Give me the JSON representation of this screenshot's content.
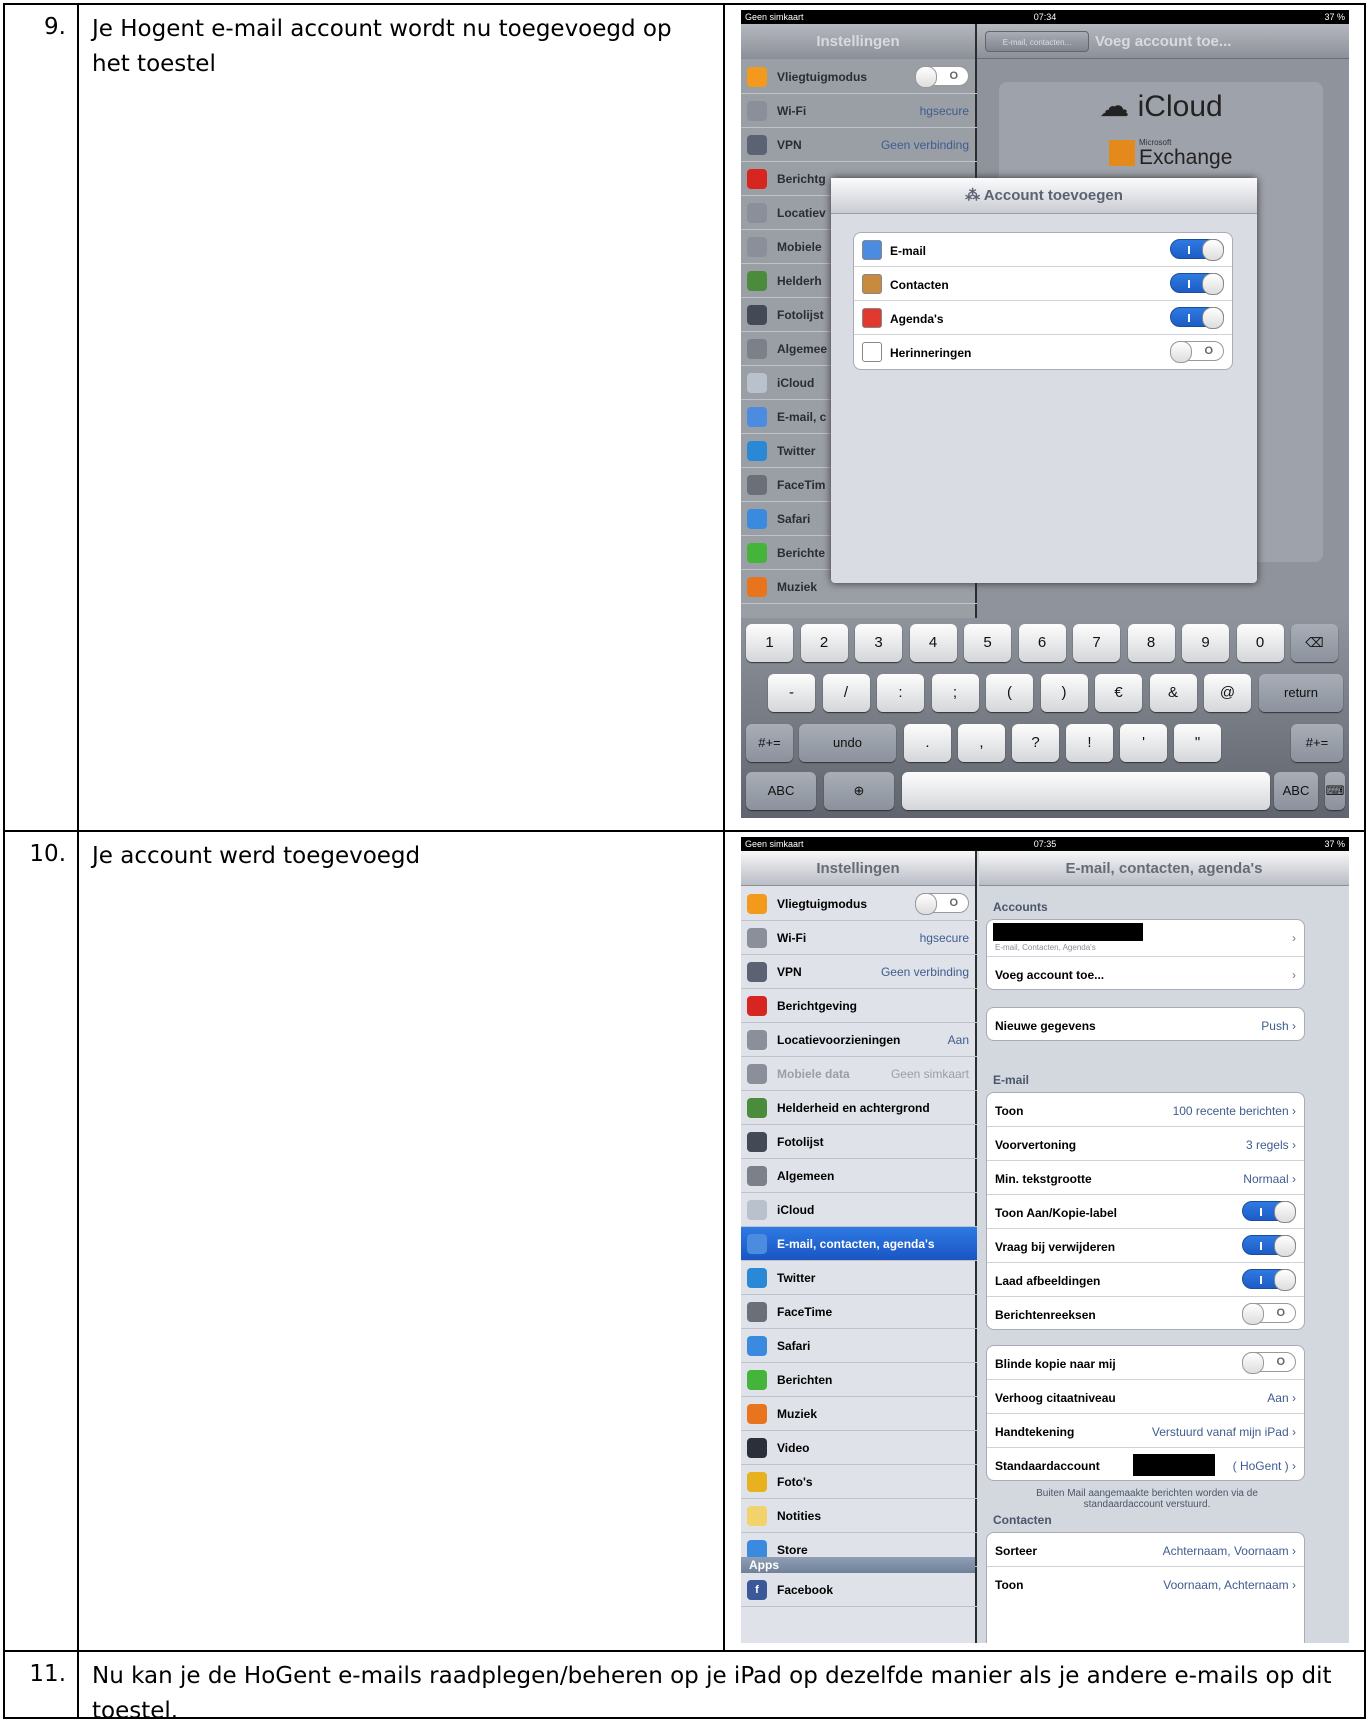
{
  "rows": [
    {
      "num": "9.",
      "text": "Je Hogent e-mail account wordt nu toegevoegd op het toestel"
    },
    {
      "num": "10.",
      "text": "Je account werd toegevoegd"
    },
    {
      "num": "11.",
      "text": "Nu kan je de HoGent e-mails raadplegen/beheren op je iPad op dezelfde manier als je andere e-mails op dit toestel."
    }
  ],
  "shot1": {
    "status": {
      "left": "Geen simkaart",
      "time": "07:34",
      "right": "37 %"
    },
    "left_title": "Instellingen",
    "back_button": "E-mail, contacten...",
    "right_title": "Voeg account toe...",
    "icloud_label": "iCloud",
    "exchange_small": "Microsoft",
    "exchange_label": "Exchange",
    "sidebar": [
      {
        "label": "Vliegtuigmodus",
        "color": "#f39a1d"
      },
      {
        "label": "Wi-Fi",
        "value": "hgsecure",
        "color": "#8a8f99"
      },
      {
        "label": "VPN",
        "value": "Geen verbinding",
        "color": "#5b6373"
      },
      {
        "label": "Berichtg",
        "color": "#d6261f"
      },
      {
        "label": "Locatiev",
        "color": "#8a8f99"
      },
      {
        "label": "Mobiele",
        "color": "#8a8f99"
      },
      {
        "label": "Helderh",
        "color": "#4a8c3c"
      },
      {
        "label": "Fotolijst",
        "color": "#444a55"
      },
      {
        "label": "Algemee",
        "color": "#7b8089"
      },
      {
        "label": "iCloud",
        "color": "#b9c2cc"
      },
      {
        "label": "E-mail, c",
        "color": "#4b8be0"
      },
      {
        "label": "Twitter",
        "color": "#2a89d6"
      },
      {
        "label": "FaceTim",
        "color": "#6a6f78"
      },
      {
        "label": "Safari",
        "color": "#3a8be0"
      },
      {
        "label": "Berichte",
        "color": "#44b53a"
      },
      {
        "label": "Muziek",
        "color": "#e8751e"
      }
    ],
    "dialog_title": "Account toevoegen",
    "dialog_items": [
      {
        "label": "E-mail",
        "on": true,
        "color": "#4b8be0"
      },
      {
        "label": "Contacten",
        "on": true,
        "color": "#c78a3f"
      },
      {
        "label": "Agenda's",
        "on": true,
        "color": "#e03a2f"
      },
      {
        "label": "Herinneringen",
        "on": false,
        "color": "#ffffff"
      }
    ],
    "kb_row1": [
      "1",
      "2",
      "3",
      "4",
      "5",
      "6",
      "7",
      "8",
      "9",
      "0",
      "⌫"
    ],
    "kb_row2": [
      "-",
      "/",
      ":",
      ";",
      "(",
      ")",
      "€",
      "&",
      "@",
      "return"
    ],
    "kb_row3": [
      "#+=",
      "undo",
      ".",
      ",",
      "?",
      "!",
      "'",
      "\"",
      "#+="
    ],
    "kb_row4": [
      "ABC",
      "⊕",
      "",
      "ABC",
      "⌨"
    ]
  },
  "shot2": {
    "status": {
      "left": "Geen simkaart",
      "time": "07:35",
      "right": "37 %"
    },
    "left_title": "Instellingen",
    "right_title": "E-mail, contacten, agenda's",
    "sidebar": [
      {
        "label": "Vliegtuigmodus",
        "color": "#f39a1d"
      },
      {
        "label": "Wi-Fi",
        "value": "hgsecure",
        "color": "#8a8f99"
      },
      {
        "label": "VPN",
        "value": "Geen verbinding",
        "color": "#5b6373"
      },
      {
        "label": "Berichtgeving",
        "color": "#d6261f"
      },
      {
        "label": "Locatievoorzieningen",
        "value": "Aan",
        "color": "#8a8f99"
      },
      {
        "label": "Mobiele data",
        "value": "Geen simkaart",
        "color": "#8a8f99",
        "dim": true
      },
      {
        "label": "Helderheid en achtergrond",
        "color": "#4a8c3c"
      },
      {
        "label": "Fotolijst",
        "color": "#444a55"
      },
      {
        "label": "Algemeen",
        "color": "#7b8089"
      },
      {
        "label": "iCloud",
        "color": "#b9c2cc"
      },
      {
        "label": "E-mail, contacten, agenda's",
        "color": "#4b8be0",
        "selected": true
      },
      {
        "label": "Twitter",
        "color": "#2a89d6"
      },
      {
        "label": "FaceTime",
        "color": "#6a6f78"
      },
      {
        "label": "Safari",
        "color": "#3a8be0"
      },
      {
        "label": "Berichten",
        "color": "#44b53a"
      },
      {
        "label": "Muziek",
        "color": "#e8751e"
      },
      {
        "label": "Video",
        "color": "#2b2f3a"
      },
      {
        "label": "Foto's",
        "color": "#e8b21e"
      },
      {
        "label": "Notities",
        "color": "#f2d36b"
      },
      {
        "label": "Store",
        "color": "#3a8be0"
      }
    ],
    "apps_header": "Apps",
    "facebook": "Facebook",
    "accounts_header": "Accounts",
    "account_sub": "E-mail, Contacten, Agenda's",
    "add_account": "Voeg account toe...",
    "new_data": {
      "label": "Nieuwe gegevens",
      "value": "Push"
    },
    "email_header": "E-mail",
    "email_rows": [
      {
        "label": "Toon",
        "value": "100 recente berichten"
      },
      {
        "label": "Voorvertoning",
        "value": "3 regels"
      },
      {
        "label": "Min. tekstgrootte",
        "value": "Normaal"
      },
      {
        "label": "Toon Aan/Kopie-label",
        "toggle": true
      },
      {
        "label": "Vraag bij verwijderen",
        "toggle": true
      },
      {
        "label": "Laad afbeeldingen",
        "toggle": true
      },
      {
        "label": "Berichtenreeksen",
        "toggle": false
      }
    ],
    "email_rows2": [
      {
        "label": "Blinde kopie naar mij",
        "toggle": false
      },
      {
        "label": "Verhoog citaatniveau",
        "value": "Aan"
      },
      {
        "label": "Handtekening",
        "value": "Verstuurd vanaf mijn iPad"
      },
      {
        "label": "Standaardaccount",
        "value": "( HoGent )"
      }
    ],
    "footnote": "Buiten Mail aangemaakte berichten worden via de standaardaccount verstuurd.",
    "contacts_header": "Contacten",
    "contacts_rows": [
      {
        "label": "Sorteer",
        "value": "Achternaam, Voornaam"
      },
      {
        "label": "Toon",
        "value": "Voornaam, Achternaam"
      }
    ]
  }
}
